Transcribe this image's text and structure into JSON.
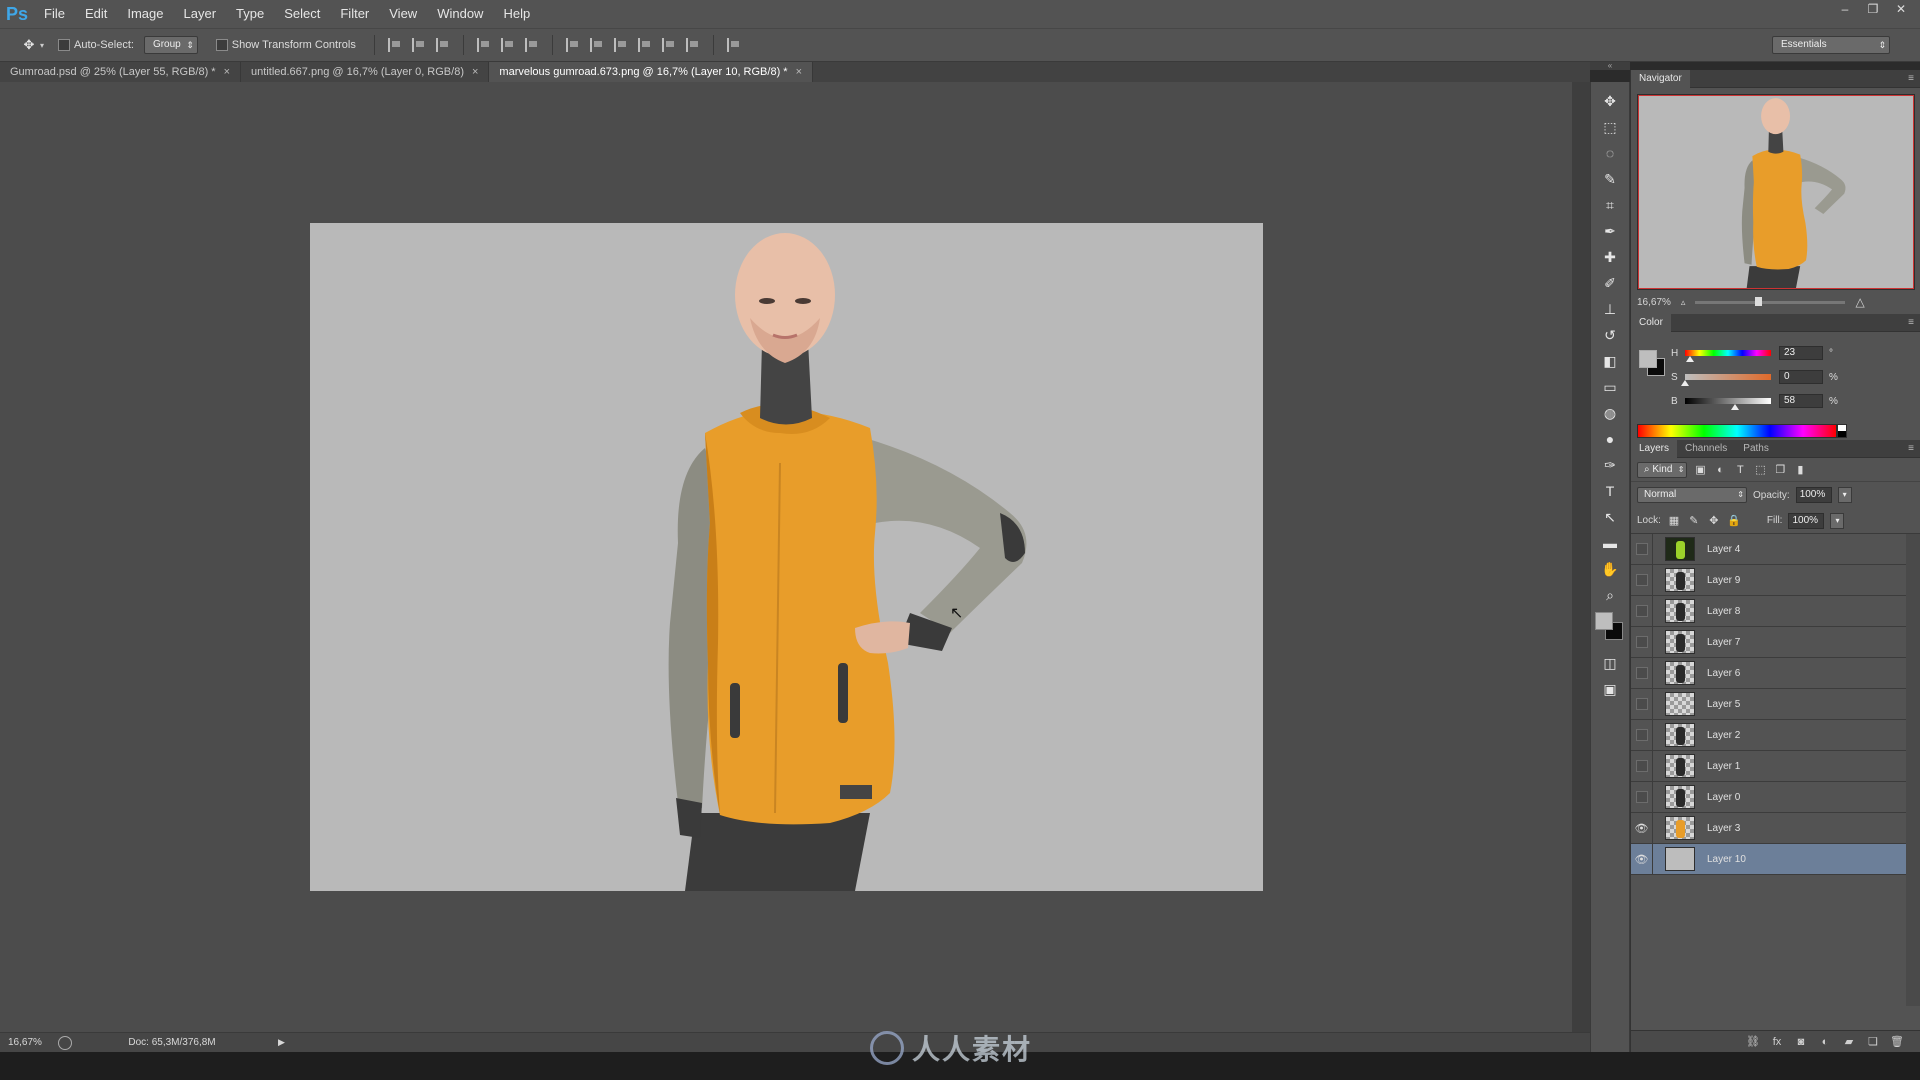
{
  "app": {
    "logo": "Ps",
    "menu": [
      "File",
      "Edit",
      "Image",
      "Layer",
      "Type",
      "Select",
      "Filter",
      "View",
      "Window",
      "Help"
    ],
    "window_controls": [
      "–",
      "❐",
      "✕"
    ]
  },
  "options_bar": {
    "auto_select_label": "Auto-Select:",
    "auto_select_checked": false,
    "auto_select_target": "Group",
    "show_transform_label": "Show Transform Controls",
    "show_transform_checked": false,
    "workspace": "Essentials"
  },
  "document_tabs": [
    {
      "label": "Gumroad.psd @ 25% (Layer 55, RGB/8) *",
      "active": false
    },
    {
      "label": "untitled.667.png @ 16,7% (Layer 0, RGB/8)",
      "active": false
    },
    {
      "label": "marvelous gumroad.673.png @ 16,7% (Layer 10, RGB/8) *",
      "active": true
    }
  ],
  "tab_close_glyph": "×",
  "status_bar": {
    "zoom": "16,67%",
    "doc": "Doc: 65,3M/376,8M",
    "arrow": "▶"
  },
  "tools": [
    {
      "icon": "move-tool-icon",
      "glyph": "✥"
    },
    {
      "icon": "marquee-tool-icon",
      "glyph": "⬚"
    },
    {
      "icon": "lasso-tool-icon",
      "glyph": "◌"
    },
    {
      "icon": "quick-select-tool-icon",
      "glyph": "✎"
    },
    {
      "icon": "crop-tool-icon",
      "glyph": "⌗"
    },
    {
      "icon": "eyedropper-tool-icon",
      "glyph": "✒"
    },
    {
      "icon": "healing-brush-tool-icon",
      "glyph": "✚"
    },
    {
      "icon": "brush-tool-icon",
      "glyph": "✐"
    },
    {
      "icon": "clone-stamp-tool-icon",
      "glyph": "⊥"
    },
    {
      "icon": "history-brush-tool-icon",
      "glyph": "↺"
    },
    {
      "icon": "eraser-tool-icon",
      "glyph": "◧"
    },
    {
      "icon": "gradient-tool-icon",
      "glyph": "▭"
    },
    {
      "icon": "blur-tool-icon",
      "glyph": "◍"
    },
    {
      "icon": "dodge-tool-icon",
      "glyph": "●"
    },
    {
      "icon": "pen-tool-icon",
      "glyph": "✑"
    },
    {
      "icon": "type-tool-icon",
      "glyph": "T"
    },
    {
      "icon": "path-select-tool-icon",
      "glyph": "↖"
    },
    {
      "icon": "shape-tool-icon",
      "glyph": "▬"
    },
    {
      "icon": "hand-tool-icon",
      "glyph": "✋"
    },
    {
      "icon": "zoom-tool-icon",
      "glyph": "⌕"
    }
  ],
  "tools_bottom": [
    {
      "icon": "quick-mask-icon",
      "glyph": "◫"
    },
    {
      "icon": "screen-mode-icon",
      "glyph": "▣"
    }
  ],
  "navigator": {
    "tab": "Navigator",
    "zoom": "16,67%",
    "zoom_slider_fraction": 0.4
  },
  "color_panel": {
    "tab": "Color",
    "foreground": "#bebebe",
    "background": "#0a0a0a",
    "h": {
      "label": "H",
      "value": "23",
      "unit": "°",
      "fraction": 0.06
    },
    "s": {
      "label": "S",
      "value": "0",
      "unit": "%",
      "fraction": 0.0
    },
    "b": {
      "label": "B",
      "value": "58",
      "unit": "%",
      "fraction": 0.58
    }
  },
  "layers_panel": {
    "tabs": [
      "Layers",
      "Channels",
      "Paths"
    ],
    "filter_kind": "Kind",
    "blend_mode": "Normal",
    "opacity_label": "Opacity:",
    "opacity": "100%",
    "lock_label": "Lock:",
    "fill_label": "Fill:",
    "fill": "100%",
    "layers": [
      {
        "name": "Layer 4",
        "visible": false,
        "selected": false,
        "thumb": "dark"
      },
      {
        "name": "Layer 9",
        "visible": false,
        "selected": false,
        "thumb": "figure"
      },
      {
        "name": "Layer 8",
        "visible": false,
        "selected": false,
        "thumb": "figure"
      },
      {
        "name": "Layer 7",
        "visible": false,
        "selected": false,
        "thumb": "figure"
      },
      {
        "name": "Layer 6",
        "visible": false,
        "selected": false,
        "thumb": "figure"
      },
      {
        "name": "Layer 5",
        "visible": false,
        "selected": false,
        "thumb": "checker"
      },
      {
        "name": "Layer 2",
        "visible": false,
        "selected": false,
        "thumb": "figure"
      },
      {
        "name": "Layer 1",
        "visible": false,
        "selected": false,
        "thumb": "figure"
      },
      {
        "name": "Layer 0",
        "visible": false,
        "selected": false,
        "thumb": "figure"
      },
      {
        "name": "Layer 3",
        "visible": true,
        "selected": false,
        "thumb": "orange"
      },
      {
        "name": "Layer 10",
        "visible": true,
        "selected": true,
        "thumb": "solid"
      }
    ],
    "footer_icons": [
      {
        "icon": "link-layers-icon",
        "glyph": "⛓"
      },
      {
        "icon": "layer-style-icon",
        "glyph": "fx"
      },
      {
        "icon": "add-mask-icon",
        "glyph": "◙"
      },
      {
        "icon": "adjustment-layer-icon",
        "glyph": "◐"
      },
      {
        "icon": "new-group-icon",
        "glyph": "▰"
      },
      {
        "icon": "new-layer-icon",
        "glyph": "❏"
      },
      {
        "icon": "delete-layer-icon",
        "glyph": "🗑"
      }
    ]
  },
  "watermark": "人人素材",
  "colors": {
    "canvas_bg": "#4c4c4c",
    "document_bg": "#b9b9b9",
    "selected_layer": "#6c7f99",
    "hoodie": "#e89d2a"
  }
}
